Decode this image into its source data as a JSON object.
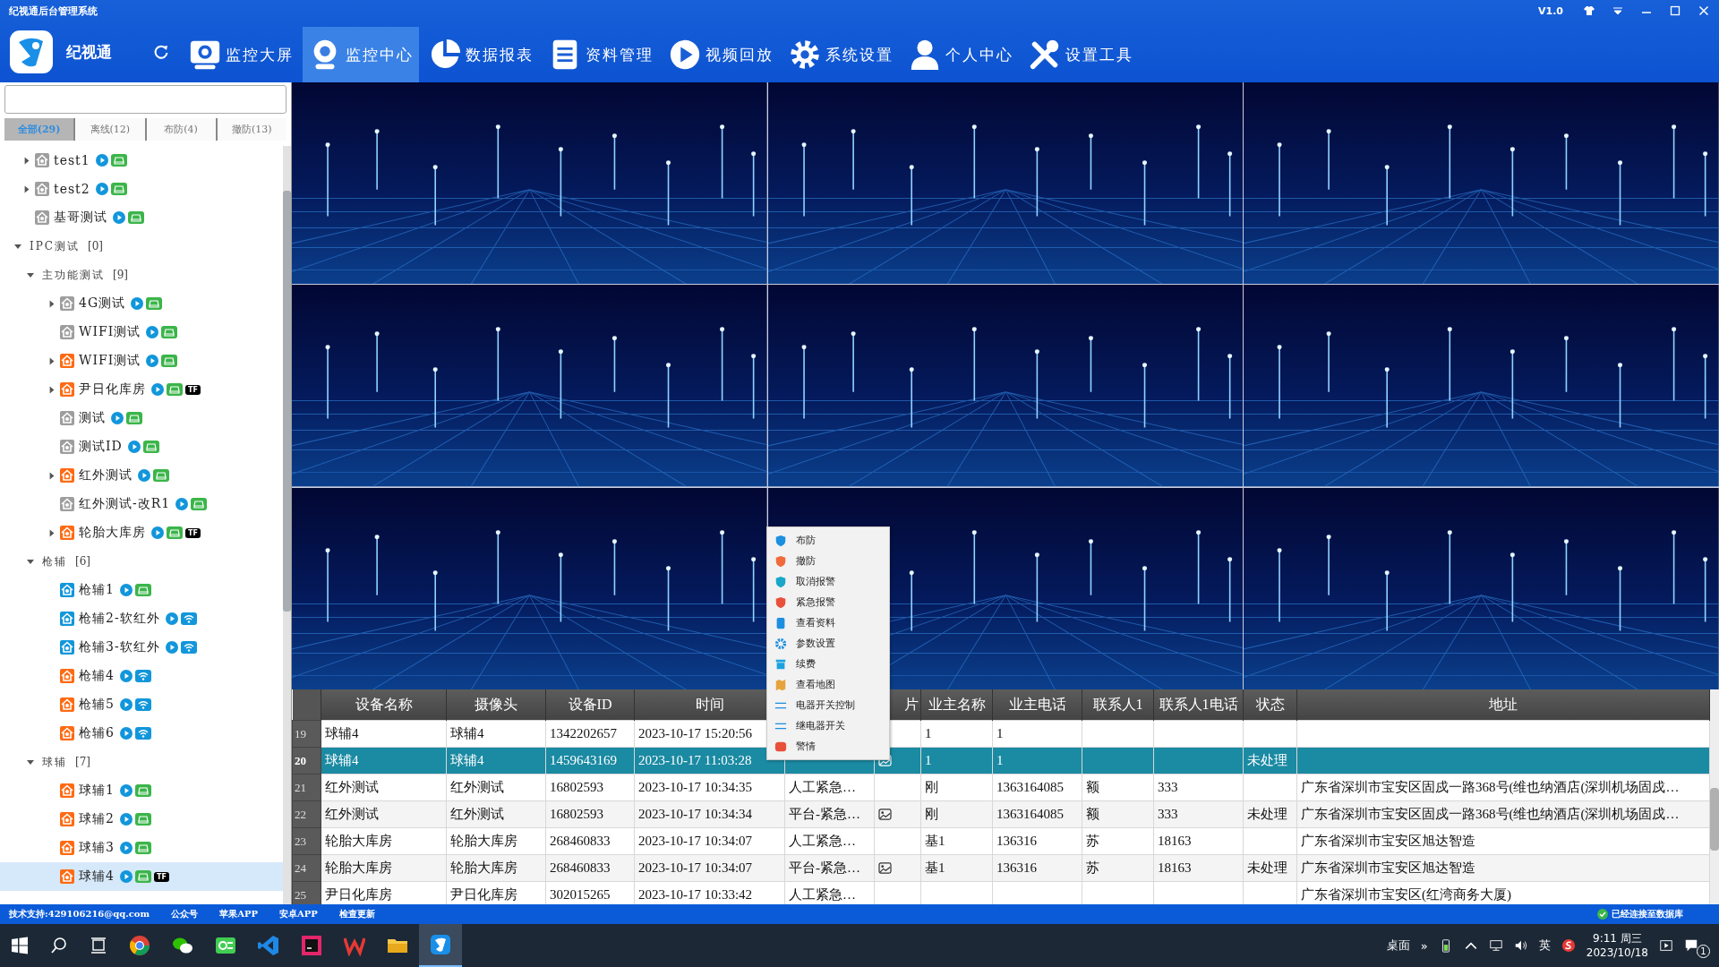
{
  "window": {
    "title": "纪视通后台管理系统",
    "version": "V1.0"
  },
  "app_name": "纪视通",
  "nav": [
    {
      "label": "监控大屏",
      "selected": false
    },
    {
      "label": "监控中心",
      "selected": true
    },
    {
      "label": "数据报表",
      "selected": false
    },
    {
      "label": "资料管理",
      "selected": false
    },
    {
      "label": "视频回放",
      "selected": false
    },
    {
      "label": "系统设置",
      "selected": false
    },
    {
      "label": "个人中心",
      "selected": false
    },
    {
      "label": "设置工具",
      "selected": false
    }
  ],
  "tabs": [
    {
      "label": "全部(29)",
      "selected": true
    },
    {
      "label": "离线(12)",
      "selected": false
    },
    {
      "label": "布防(4)",
      "selected": false
    },
    {
      "label": "撤防(13)",
      "selected": false
    }
  ],
  "tree": [
    {
      "kind": "disk-device",
      "label": "test1",
      "expanded": false,
      "color": "#9e9e9e",
      "selected": false
    },
    {
      "kind": "disk-device",
      "label": "test2",
      "expanded": false,
      "color": "#9e9e9e",
      "selected": false
    },
    {
      "kind": "disk-device",
      "label": "基哥测试",
      "color": "#9e9e9e",
      "selected": false
    },
    {
      "kind": "group",
      "label": "IPC测试",
      "count": "[0]",
      "expanded": true,
      "selected": false,
      "children": [
        {
          "kind": "group",
          "label": "主功能测试",
          "count": "[9]",
          "expanded": true,
          "selected": false,
          "children": [
            {
              "kind": "disk-device",
              "label": "4G测试",
              "expanded": false,
              "color": "#9e9e9e",
              "selected": false
            },
            {
              "kind": "disk-device",
              "label": "WIFI测试",
              "color": "#9e9e9e",
              "selected": false
            },
            {
              "kind": "disk-device",
              "label": "WIFI测试",
              "expanded": false,
              "color": "#ff6a13",
              "selected": false
            },
            {
              "kind": "disk-device",
              "label": "尹日化库房",
              "expanded": false,
              "color": "#ff6a13",
              "tf": "TF",
              "selected": false
            },
            {
              "kind": "disk-device",
              "label": "测试",
              "color": "#9e9e9e",
              "selected": false
            },
            {
              "kind": "disk-device",
              "label": "测试ID",
              "color": "#9e9e9e",
              "selected": false
            },
            {
              "kind": "disk-device",
              "label": "红外测试",
              "expanded": false,
              "color": "#ff6a13",
              "selected": false
            },
            {
              "kind": "disk-device",
              "label": "红外测试-改R1",
              "color": "#9e9e9e",
              "selected": false
            },
            {
              "kind": "disk-device",
              "label": "轮胎大库房",
              "expanded": false,
              "color": "#ff6a13",
              "tf": "TF",
              "selected": false
            }
          ]
        },
        {
          "kind": "group",
          "label": "枪辅",
          "count": "[6]",
          "expanded": true,
          "selected": false,
          "children": [
            {
              "kind": "disk-device",
              "label": "枪辅1",
              "color": "#1296db",
              "selected": false
            },
            {
              "kind": "wifi-device",
              "label": "枪辅2-软红外",
              "color": "#1296db",
              "selected": false
            },
            {
              "kind": "wifi-device",
              "label": "枪辅3-软红外",
              "color": "#1296db",
              "selected": false
            },
            {
              "kind": "wifi-device",
              "label": "枪辅4",
              "color": "#ff6a13",
              "selected": false
            },
            {
              "kind": "wifi-device",
              "label": "枪辅5",
              "color": "#ff6a13",
              "selected": false
            },
            {
              "kind": "wifi-device",
              "label": "枪辅6",
              "color": "#ff6a13",
              "selected": false
            }
          ]
        },
        {
          "kind": "group",
          "label": "球辅",
          "count": "[7]",
          "expanded": true,
          "selected": false,
          "children": [
            {
              "kind": "disk-device",
              "label": "球辅1",
              "color": "#ff6a13",
              "selected": false
            },
            {
              "kind": "disk-device",
              "label": "球辅2",
              "color": "#ff6a13",
              "selected": false
            },
            {
              "kind": "disk-device",
              "label": "球辅3",
              "color": "#ff6a13",
              "selected": false
            },
            {
              "kind": "disk-device",
              "label": "球辅4",
              "color": "#ff6a13",
              "tf": "TF",
              "selected": true
            }
          ]
        }
      ]
    }
  ],
  "context_menu": [
    "布防",
    "撤防",
    "取消报警",
    "紧急报警",
    "查看资料",
    "参数设置",
    "续费",
    "查看地图",
    "电器开关控制",
    "继电器开关",
    "警情"
  ],
  "table": {
    "columns": [
      {},
      {
        "label": "设备名称"
      },
      {
        "label": "摄像头"
      },
      {
        "label": "设备ID"
      },
      {
        "label": "时间"
      },
      {},
      {
        "label": "片"
      },
      {
        "label": "业主名称"
      },
      {
        "label": "业主电话"
      },
      {
        "label": "联系人1"
      },
      {
        "label": "联系人1电话"
      },
      {
        "label": "状态"
      },
      {
        "label": "地址"
      }
    ],
    "rows": [
      {
        "selected": false,
        "image": false,
        "cells": [
          "19",
          "球辅4",
          "球辅4",
          "1342202657",
          "2023-10-17 15:20:56",
          null,
          null,
          "1",
          "1",
          null,
          null,
          null,
          null
        ]
      },
      {
        "selected": true,
        "image": true,
        "cells": [
          "20",
          "球辅4",
          "球辅4",
          "1459643169",
          "2023-10-17 11:03:28",
          null,
          null,
          "1",
          "1",
          null,
          null,
          "未处理",
          null
        ]
      },
      {
        "selected": false,
        "image": false,
        "cells": [
          "21",
          "红外测试",
          "红外测试",
          "16802593",
          "2023-10-17 10:34:35",
          "人工紧急…",
          null,
          "刚",
          "1363164085",
          "额",
          "333",
          null,
          "广东省深圳市宝安区固戍一路368号(维也纳酒店(深圳机场固戍…"
        ]
      },
      {
        "selected": false,
        "image": true,
        "cells": [
          "22",
          "红外测试",
          "红外测试",
          "16802593",
          "2023-10-17 10:34:34",
          "平台-紧急…",
          null,
          "刚",
          "1363164085",
          "额",
          "333",
          "未处理",
          "广东省深圳市宝安区固戍一路368号(维也纳酒店(深圳机场固戍…"
        ]
      },
      {
        "selected": false,
        "image": false,
        "cells": [
          "23",
          "轮胎大库房",
          "轮胎大库房",
          "268460833",
          "2023-10-17 10:34:07",
          "人工紧急…",
          null,
          "基1",
          "136316",
          "苏",
          "18163",
          null,
          "广东省深圳市宝安区旭达智造"
        ]
      },
      {
        "selected": false,
        "image": true,
        "cells": [
          "24",
          "轮胎大库房",
          "轮胎大库房",
          "268460833",
          "2023-10-17 10:34:07",
          "平台-紧急…",
          null,
          "基1",
          "136316",
          "苏",
          "18163",
          "未处理",
          "广东省深圳市宝安区旭达智造"
        ]
      },
      {
        "selected": false,
        "image": false,
        "cells": [
          "25",
          "尹日化库房",
          "尹日化库房",
          "302015265",
          "2023-10-17 10:33:42",
          "人工紧急…",
          null,
          null,
          null,
          null,
          null,
          null,
          "广东省深圳市宝安区(红湾商务大厦)"
        ]
      }
    ]
  },
  "status_bar": {
    "links": [
      "技术支持:429106216@qq.com",
      "公众号",
      "苹果APP",
      "安卓APP",
      "检查更新"
    ],
    "connection": "已经连接至数据库"
  },
  "taskbar": {
    "desktop": "桌面",
    "more": "»",
    "ime": "英",
    "time": "9:11 周三",
    "date": "2023/10/18",
    "notifications": "1"
  }
}
